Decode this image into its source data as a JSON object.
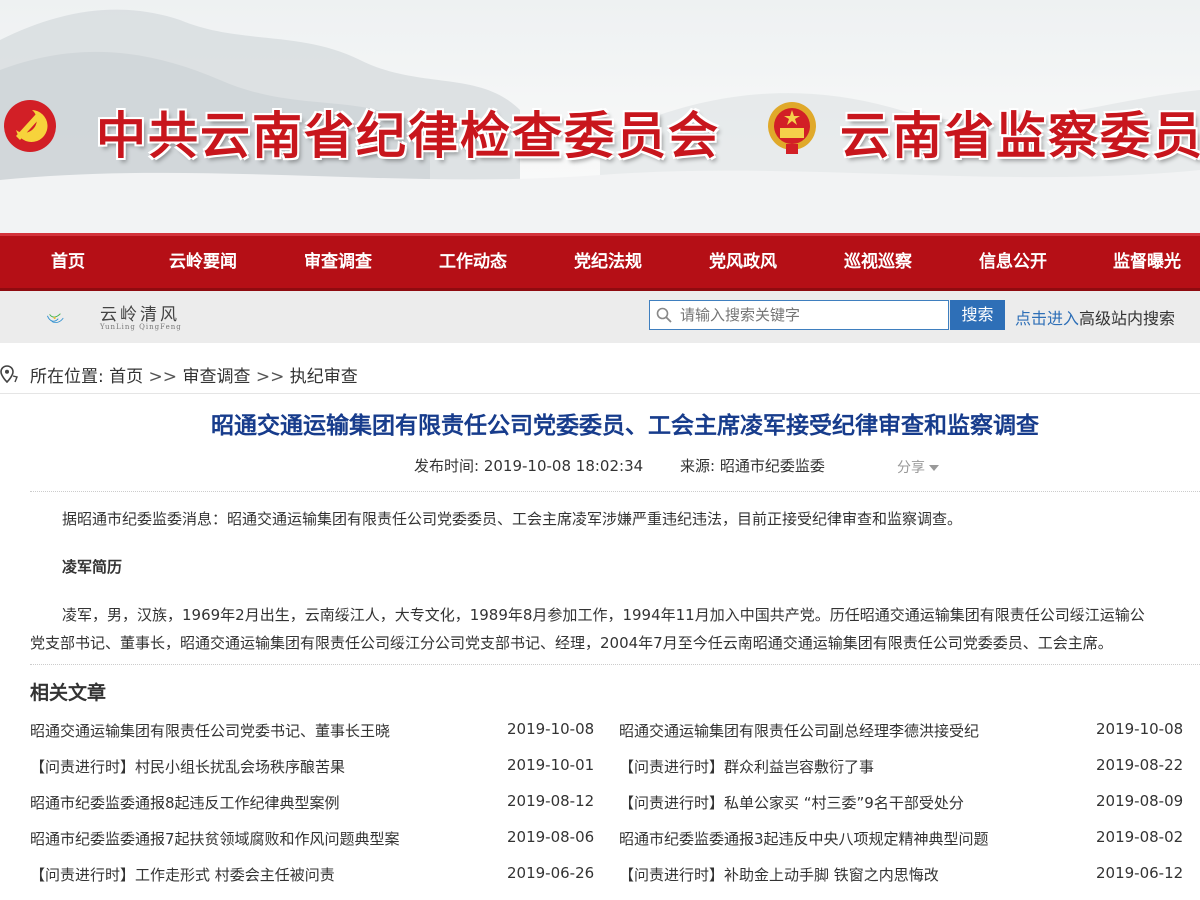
{
  "banner": {
    "title_left": "中共云南省纪律检查委员会",
    "title_right": "云南省监察委员会"
  },
  "nav": {
    "items": [
      "首页",
      "云岭要闻",
      "审查调查",
      "工作动态",
      "党纪法规",
      "党风政风",
      "巡视巡察",
      "信息公开",
      "监督曝光"
    ]
  },
  "logo": {
    "name": "云岭清风",
    "subtitle": "YunLing QingFeng"
  },
  "search": {
    "placeholder": "请输入搜索关键字",
    "button": "搜索",
    "advanced_link": "点击进入",
    "advanced_text": "高级站内搜索"
  },
  "breadcrumb": {
    "label": "所在位置:",
    "items": [
      "首页",
      "审查调查",
      "执纪审查"
    ],
    "separator": ">>"
  },
  "article": {
    "title": "昭通交通运输集团有限责任公司党委委员、工会主席凌军接受纪律审查和监察调查",
    "publish_label": "发布时间:",
    "publish_time": "2019-10-08 18:02:34",
    "source_label": "来源:",
    "source": "昭通市纪委监委",
    "share": "分享",
    "paragraph1": "据昭通市纪委监委消息：昭通交通运输集团有限责任公司党委委员、工会主席凌军涉嫌严重违纪违法，目前正接受纪律审查和监察调查。",
    "bio_heading": "凌军简历",
    "bio_line1": "凌军，男，汉族，1969年2月出生，云南绥江人，大专文化，1989年8月参加工作，1994年11月加入中国共产党。历任昭通交通运输集团有限责任公司绥江运输公",
    "bio_line2": "党支部书记、董事长，昭通交通运输集团有限责任公司绥江分公司党支部书记、经理，2004年7月至今任云南昭通交通运输集团有限责任公司党委委员、工会主席。"
  },
  "related": {
    "heading": "相关文章",
    "rows": [
      {
        "left_title": "昭通交通运输集团有限责任公司党委书记、董事长王晓",
        "left_date": "2019-10-08",
        "right_title": "昭通交通运输集团有限责任公司副总经理李德洪接受纪",
        "right_date": "2019-10-08"
      },
      {
        "left_title": "【问责进行时】村民小组长扰乱会场秩序酿苦果",
        "left_date": "2019-10-01",
        "right_title": "【问责进行时】群众利益岂容敷衍了事",
        "right_date": "2019-08-22"
      },
      {
        "left_title": "昭通市纪委监委通报8起违反工作纪律典型案例",
        "left_date": "2019-08-12",
        "right_title": "【问责进行时】私单公家买 “村三委”9名干部受处分",
        "right_date": "2019-08-09"
      },
      {
        "left_title": "昭通市纪委监委通报7起扶贫领域腐败和作风问题典型案",
        "left_date": "2019-08-06",
        "right_title": "昭通市纪委监委通报3起违反中央八项规定精神典型问题",
        "right_date": "2019-08-02"
      },
      {
        "left_title": "【问责进行时】工作走形式 村委会主任被问责",
        "left_date": "2019-06-26",
        "right_title": "【问责进行时】补助金上动手脚 铁窗之内思悔改",
        "right_date": "2019-06-12"
      }
    ]
  },
  "colors": {
    "brand_red": "#b50f16",
    "title_blue": "#173c8c",
    "link_blue": "#2e6fb7"
  }
}
